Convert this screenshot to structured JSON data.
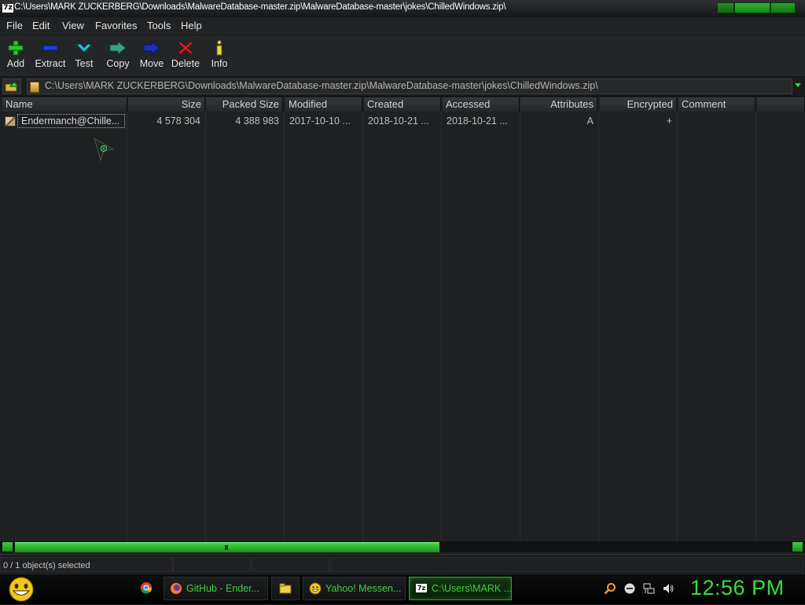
{
  "window": {
    "app_badge": "7z",
    "title": "C:\\Users\\MARK ZUCKERBERG\\Downloads\\MalwareDatabase-master.zip\\MalwareDatabase-master\\jokes\\ChilledWindows.zip\\"
  },
  "menu": [
    "File",
    "Edit",
    "View",
    "Favorites",
    "Tools",
    "Help"
  ],
  "toolbar": {
    "add": "Add",
    "extract": "Extract",
    "test": "Test",
    "copy": "Copy",
    "move": "Move",
    "delete": "Delete",
    "info": "Info"
  },
  "address": {
    "path": "C:\\Users\\MARK ZUCKERBERG\\Downloads\\MalwareDatabase-master.zip\\MalwareDatabase-master\\jokes\\ChilledWindows.zip\\"
  },
  "columns": [
    "Name",
    "Size",
    "Packed Size",
    "Modified",
    "Created",
    "Accessed",
    "Attributes",
    "Encrypted",
    "Comment"
  ],
  "files": [
    {
      "name": "Endermanch@Chille...",
      "size": "4 578 304",
      "packed_size": "4 388 983",
      "modified": "2017-10-10 ...",
      "created": "2018-10-21 ...",
      "accessed": "2018-10-21 ...",
      "attributes": "A",
      "encrypted": "+",
      "comment": ""
    }
  ],
  "status": {
    "selection": "0 / 1 object(s) selected"
  },
  "taskbar": {
    "tasks": [
      {
        "label": "GitHub - Ender...",
        "icon": "firefox-icon"
      },
      {
        "label": "",
        "icon": "folder-icon"
      },
      {
        "label": "Yahoo! Messen...",
        "icon": "yahoo-messenger-icon"
      },
      {
        "label": "C:\\Users\\MARK ...",
        "icon": "7zip-icon"
      }
    ],
    "clock": "12:56 PM"
  },
  "colors": {
    "accent_green": "#3fd13f",
    "background": "#1d1f21"
  }
}
